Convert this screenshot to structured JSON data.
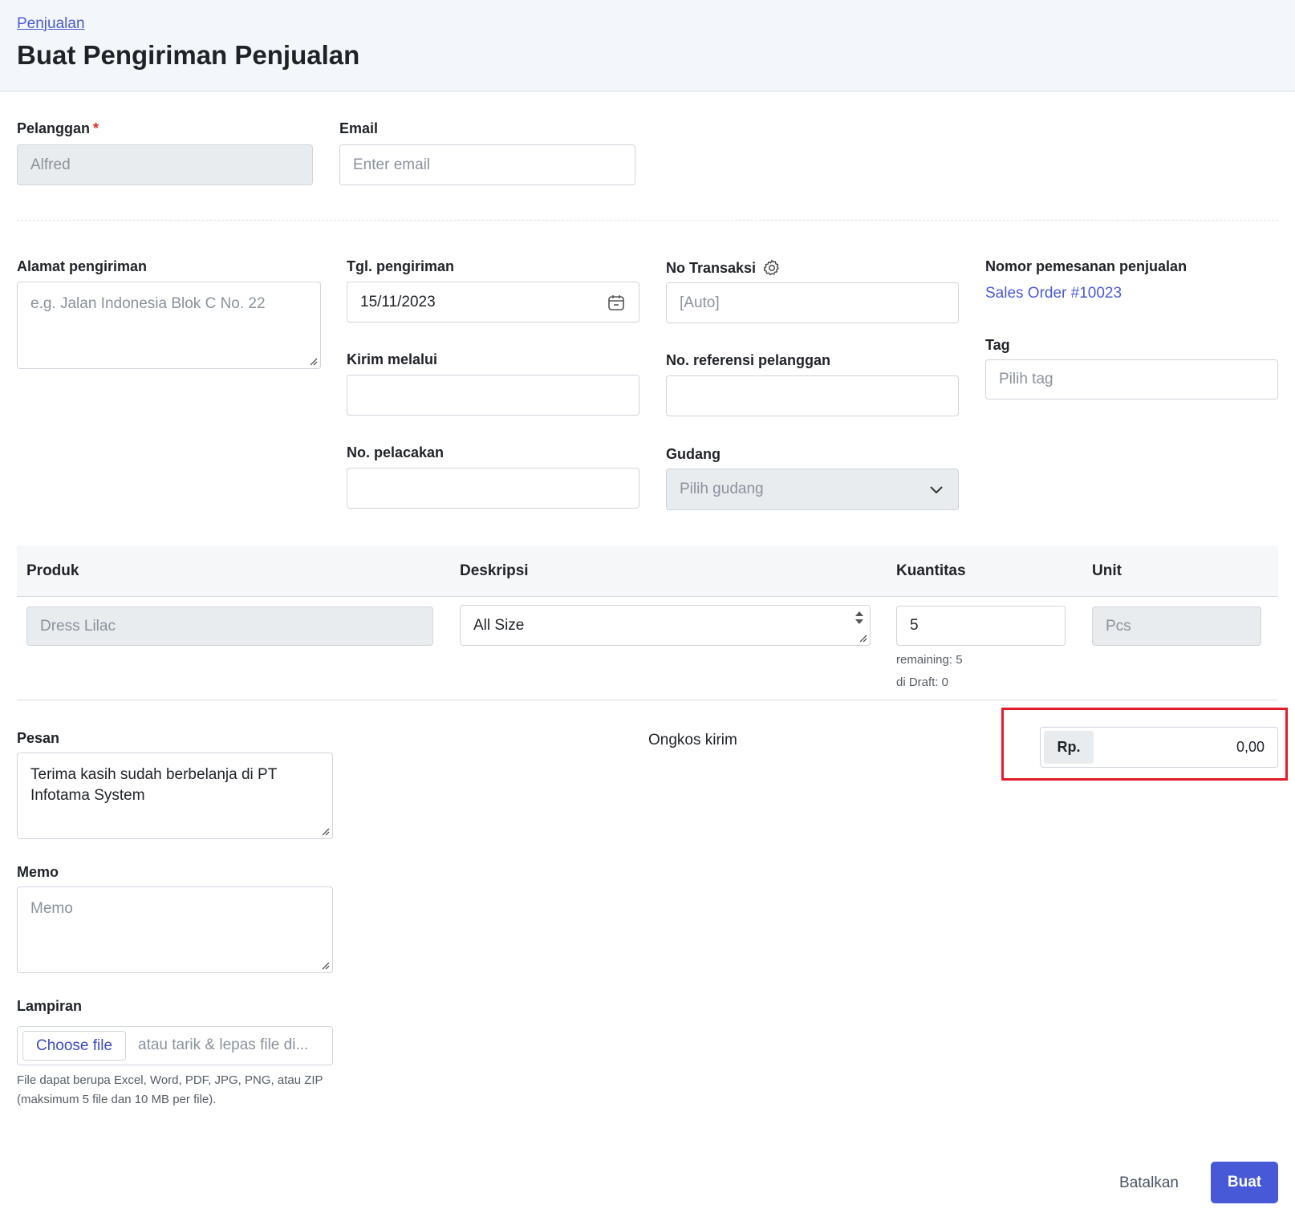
{
  "header": {
    "breadcrumb": "Penjualan",
    "title": "Buat Pengiriman Penjualan"
  },
  "customer": {
    "label": "Pelanggan",
    "required_mark": "*",
    "value": "Alfred"
  },
  "email": {
    "label": "Email",
    "placeholder": "Enter email"
  },
  "shipping_address": {
    "label": "Alamat pengiriman",
    "placeholder": "e.g. Jalan Indonesia Blok C No. 22"
  },
  "shipping_date": {
    "label": "Tgl. pengiriman",
    "value": "15/11/2023"
  },
  "transaction_no": {
    "label": "No Transaksi",
    "placeholder": "[Auto]"
  },
  "sales_order": {
    "label": "Nomor pemesanan penjualan",
    "link": "Sales Order #10023"
  },
  "ship_via": {
    "label": "Kirim melalui",
    "value": ""
  },
  "customer_ref": {
    "label": "No. referensi pelanggan",
    "value": ""
  },
  "tag": {
    "label": "Tag",
    "placeholder": "Pilih tag"
  },
  "tracking_no": {
    "label": "No. pelacakan",
    "value": ""
  },
  "warehouse": {
    "label": "Gudang",
    "placeholder": "Pilih gudang"
  },
  "table": {
    "headers": {
      "product": "Produk",
      "description": "Deskripsi",
      "quantity": "Kuantitas",
      "unit": "Unit"
    },
    "rows": [
      {
        "product": "Dress Lilac",
        "description": "All Size",
        "quantity": "5",
        "unit": "Pcs",
        "remaining": "remaining: 5",
        "draft": "di Draft: 0"
      }
    ]
  },
  "message": {
    "label": "Pesan",
    "value": "Terima kasih sudah berbelanja di PT Infotama System"
  },
  "shipping_cost": {
    "label": "Ongkos kirim",
    "currency": "Rp.",
    "value": "0,00"
  },
  "memo": {
    "label": "Memo",
    "placeholder": "Memo"
  },
  "attachment": {
    "label": "Lampiran",
    "button": "Choose file",
    "drop_hint": "atau tarik & lepas file di...",
    "note": "File dapat berupa Excel, Word, PDF, JPG, PNG, atau ZIP (maksimum 5 file dan 10 MB per file)."
  },
  "actions": {
    "cancel": "Batalkan",
    "create": "Buat"
  },
  "colors": {
    "primary": "#4759d6",
    "link": "#4a5bd4",
    "highlight": "#e11d2a",
    "required": "#d92d20"
  }
}
